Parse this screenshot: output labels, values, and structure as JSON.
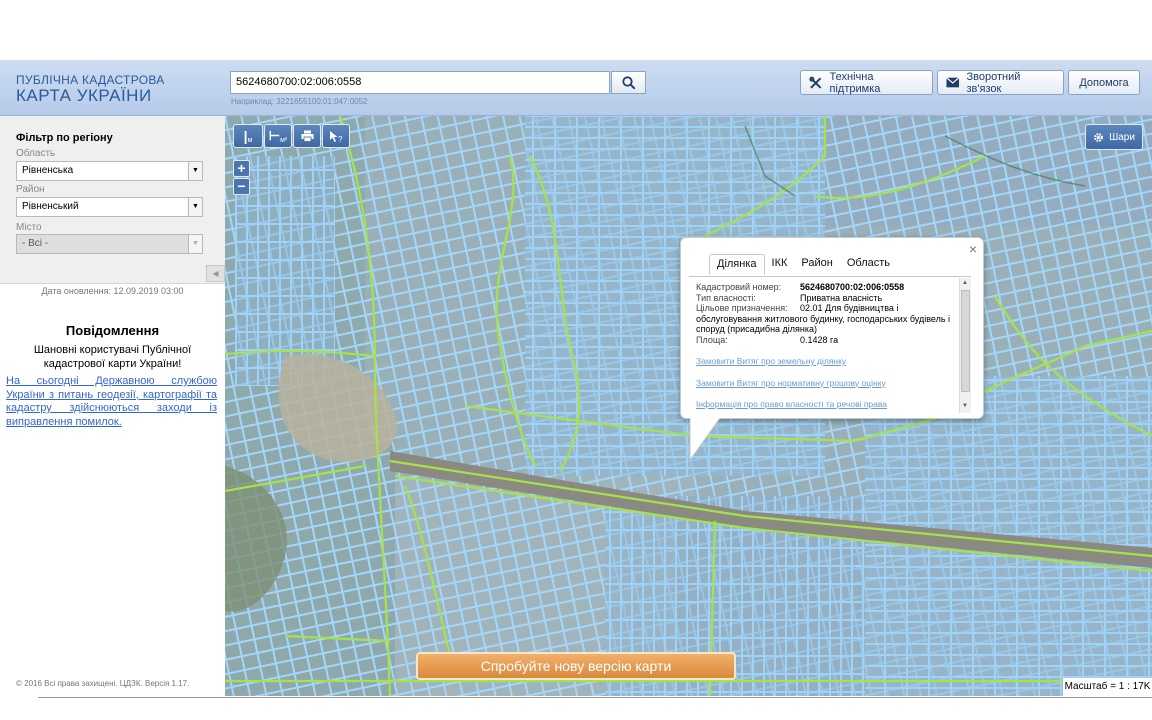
{
  "header": {
    "logo_line1": "ПУБЛІЧНА КАДАСТРОВА",
    "logo_line2": "КАРТА УКРАЇНИ",
    "search_value": "5624680700:02:006:0558",
    "search_hint": "Наприклад: 3221655100:01:047:0052",
    "search_icon": "search-icon",
    "support_label": "Технічна підтримка",
    "feedback_label": "Зворотний зв'язок",
    "help_label": "Допомога"
  },
  "sidebar": {
    "filter_title": "Фільтр по регіону",
    "oblast_label": "Область",
    "oblast_value": "Рівненська",
    "rayon_label": "Район",
    "rayon_value": "Рівненський",
    "city_label": "Місто",
    "city_value": "- Всі -",
    "update_date": "Дата оновлення: 12.09.2019 03:00",
    "notice_title": "Повідомлення",
    "notice_text": "Шановні користувачі Публічної кадастрової карти України!",
    "notice_link": "На сьогодні Державною службою України з питань геодезії, картографії та кадастру здійснюються заходи із виправлення помилок.",
    "copyright": "© 2016 Всі права захищені. ЦДЗК. Версія 1.17."
  },
  "map": {
    "tool_measure": "м",
    "tool_area": "м²",
    "tool_print_icon": "print-icon",
    "tool_identify_icon": "identify-cursor-icon",
    "zoom_in": "+",
    "zoom_out": "−",
    "layers_label": "Шари",
    "try_new_label": "Спробуйте нову версію карти",
    "scale_label": "Масштаб = 1 : 17K"
  },
  "popup": {
    "close": "×",
    "tabs": [
      "Ділянка",
      "ІКК",
      "Район",
      "Область"
    ],
    "active_tab": "Ділянка",
    "cadastral_label": "Кадастровий номер:",
    "cadastral_value": "5624680700:02:006:0558",
    "ownership_label": "Тип власності:",
    "ownership_value": "Приватна власність",
    "purpose_label": "Цільове призначення:",
    "purpose_value": "02.01 Для будівництва і",
    "purpose_cont": "обслуговування житлового будинку, господарських будівель і споруд (присадибна ділянка)",
    "area_label": "Площа:",
    "area_value": "0.1428 га",
    "link1": "Замовити Витяг про земельну ділянку",
    "link2": "Замовити Витяг про нормативну грошову оцінку",
    "link3": "Інформація про право власності та речові права"
  },
  "colors": {
    "header_blue": "#2a5a9c",
    "parcel_blue": "#8fc3f0",
    "boundary_green": "#9ee04a",
    "try_button_orange": "#e69a4c"
  }
}
